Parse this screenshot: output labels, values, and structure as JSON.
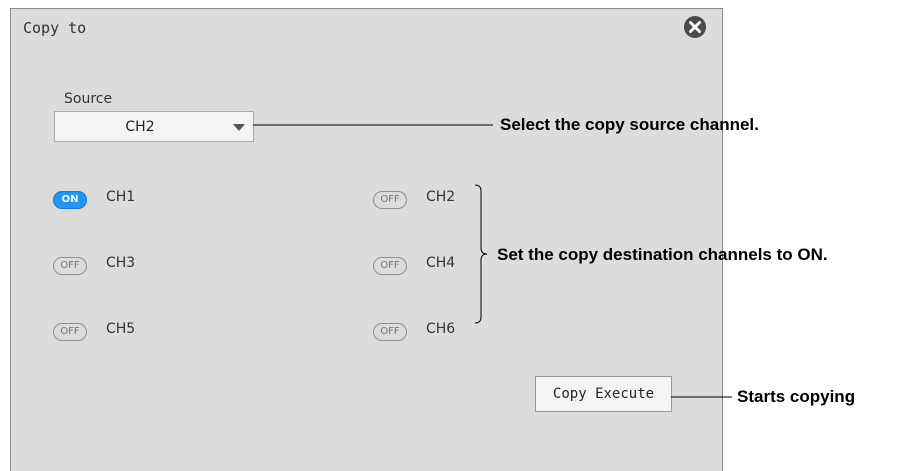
{
  "dialog": {
    "title": "Copy to",
    "close_icon": "close-icon",
    "source_label": "Source",
    "source_value": "CH2",
    "channels": [
      {
        "name": "CH1",
        "state": "ON"
      },
      {
        "name": "CH2",
        "state": "OFF"
      },
      {
        "name": "CH3",
        "state": "OFF"
      },
      {
        "name": "CH4",
        "state": "OFF"
      },
      {
        "name": "CH5",
        "state": "OFF"
      },
      {
        "name": "CH6",
        "state": "OFF"
      }
    ],
    "execute_label": "Copy Execute"
  },
  "annotations": {
    "source": "Select the copy source channel.",
    "destination": "Set the copy destination channels to ON.",
    "execute": "Starts copying"
  },
  "colors": {
    "toggle_on": "#2196f3",
    "dialog_bg": "#dcdcdc"
  }
}
